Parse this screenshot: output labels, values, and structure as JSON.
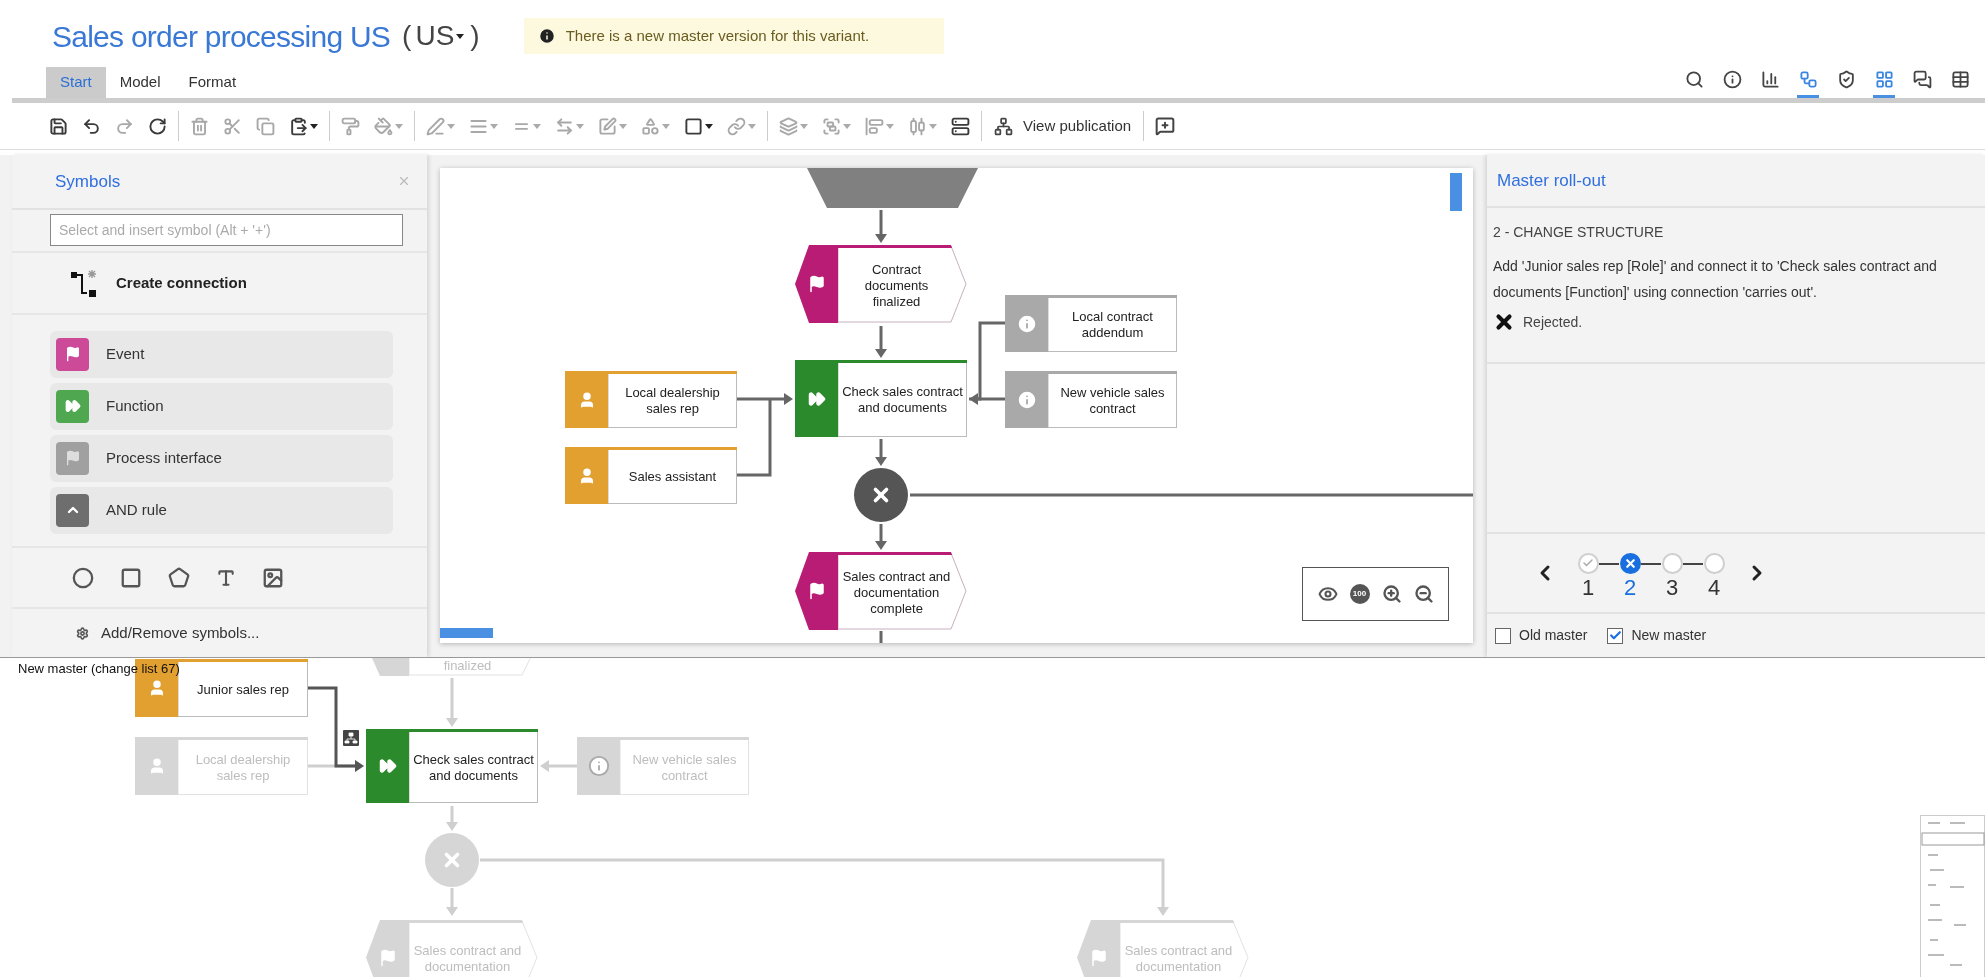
{
  "header": {
    "title": "Sales order processing US",
    "variant": {
      "open": "(",
      "value": "US",
      "close": ")"
    },
    "notice": "There is a new master version for this variant."
  },
  "tabs": [
    {
      "label": "Start",
      "selected": true
    },
    {
      "label": "Model",
      "selected": false
    },
    {
      "label": "Format",
      "selected": false
    }
  ],
  "view_icons": [
    {
      "selected": false
    },
    {
      "selected": false
    },
    {
      "selected": false
    },
    {
      "selected": true
    },
    {
      "selected": false
    },
    {
      "selected": true
    },
    {
      "selected": false
    },
    {
      "selected": false
    }
  ],
  "toolbar": [
    [
      {
        "dropdown": false,
        "disabled": false
      },
      {
        "dropdown": false,
        "disabled": false
      },
      {
        "dropdown": false,
        "disabled": true
      },
      {
        "dropdown": false,
        "disabled": false
      }
    ],
    [
      {
        "dropdown": false,
        "disabled": true
      },
      {
        "dropdown": false,
        "disabled": true
      },
      {
        "dropdown": false,
        "disabled": true
      },
      {
        "dropdown": true,
        "disabled": false
      }
    ],
    [
      {
        "dropdown": false,
        "disabled": true
      },
      {
        "dropdown": true,
        "disabled": true
      }
    ],
    [
      {
        "dropdown": true,
        "disabled": true
      },
      {
        "dropdown": true,
        "disabled": true
      },
      {
        "dropdown": true,
        "disabled": true
      },
      {
        "dropdown": true,
        "disabled": true
      },
      {
        "dropdown": true,
        "disabled": true
      },
      {
        "dropdown": true,
        "disabled": true
      },
      {
        "dropdown": true,
        "disabled": false
      },
      {
        "dropdown": true,
        "disabled": true
      }
    ],
    [
      {
        "dropdown": true,
        "disabled": true
      },
      {
        "dropdown": true,
        "disabled": true
      },
      {
        "dropdown": true,
        "disabled": true
      },
      {
        "dropdown": true,
        "disabled": true
      },
      {
        "dropdown": false,
        "disabled": false
      }
    ]
  ],
  "publication_button": "View publication",
  "symbols_panel": {
    "title": "Symbols",
    "search_placeholder": "Select and insert symbol (Alt + '+')",
    "create_connection": "Create connection",
    "items": [
      {
        "kind": "event",
        "label": "Event"
      },
      {
        "kind": "function",
        "label": "Function"
      },
      {
        "kind": "interface",
        "label": "Process interface"
      },
      {
        "kind": "and_rule",
        "label": "AND rule"
      }
    ],
    "footer": "Add/Remove symbols..."
  },
  "canvas": {
    "nodes": [
      {
        "kind": "trapezoid"
      },
      {
        "kind": "event",
        "label": "Contract documents finalized"
      },
      {
        "kind": "info",
        "label": "Local contract addendum"
      },
      {
        "kind": "role",
        "label": "Local dealership sales rep"
      },
      {
        "kind": "function",
        "label": "Check sales contract and documents"
      },
      {
        "kind": "info",
        "label": "New vehicle sales contract"
      },
      {
        "kind": "role",
        "label": "Sales assistant"
      },
      {
        "kind": "xor"
      },
      {
        "kind": "event",
        "label": "Sales contract and documentation complete"
      }
    ],
    "zoom_reset": "100"
  },
  "rollout_panel": {
    "title": "Master roll-out",
    "step_title": "2 - CHANGE STRUCTURE",
    "description": "Add 'Junior sales rep [Role]' and connect it to 'Check sales contract and documents [Function]' using connection 'carries out'.",
    "result": "Rejected.",
    "steps": [
      {
        "label": "1",
        "accepted": true,
        "rejected": false,
        "selected": false
      },
      {
        "label": "2",
        "accepted": false,
        "rejected": true,
        "selected": true
      },
      {
        "label": "3",
        "accepted": false,
        "rejected": false,
        "selected": false
      },
      {
        "label": "4",
        "accepted": false,
        "rejected": false,
        "selected": false
      }
    ],
    "options": [
      {
        "label": "Old master",
        "checked": false
      },
      {
        "label": "New master",
        "checked": true
      }
    ]
  },
  "compare_canvas": {
    "caption": "New master (change list 67)",
    "nodes": [
      {
        "kind": "event",
        "label": "finalized",
        "faded": true
      },
      {
        "kind": "role",
        "label": "Junior sales rep",
        "faded": false
      },
      {
        "kind": "role",
        "label": "Local dealership sales rep",
        "faded": true
      },
      {
        "kind": "function",
        "label": "Check sales contract and documents",
        "faded": false
      },
      {
        "kind": "info",
        "label": "New vehicle sales contract",
        "faded": true
      },
      {
        "kind": "xor",
        "faded": true
      },
      {
        "kind": "event",
        "label": "Sales contract and documentation",
        "faded": true
      },
      {
        "kind": "event",
        "label": "Sales contract and documentation",
        "faded": true
      }
    ]
  }
}
